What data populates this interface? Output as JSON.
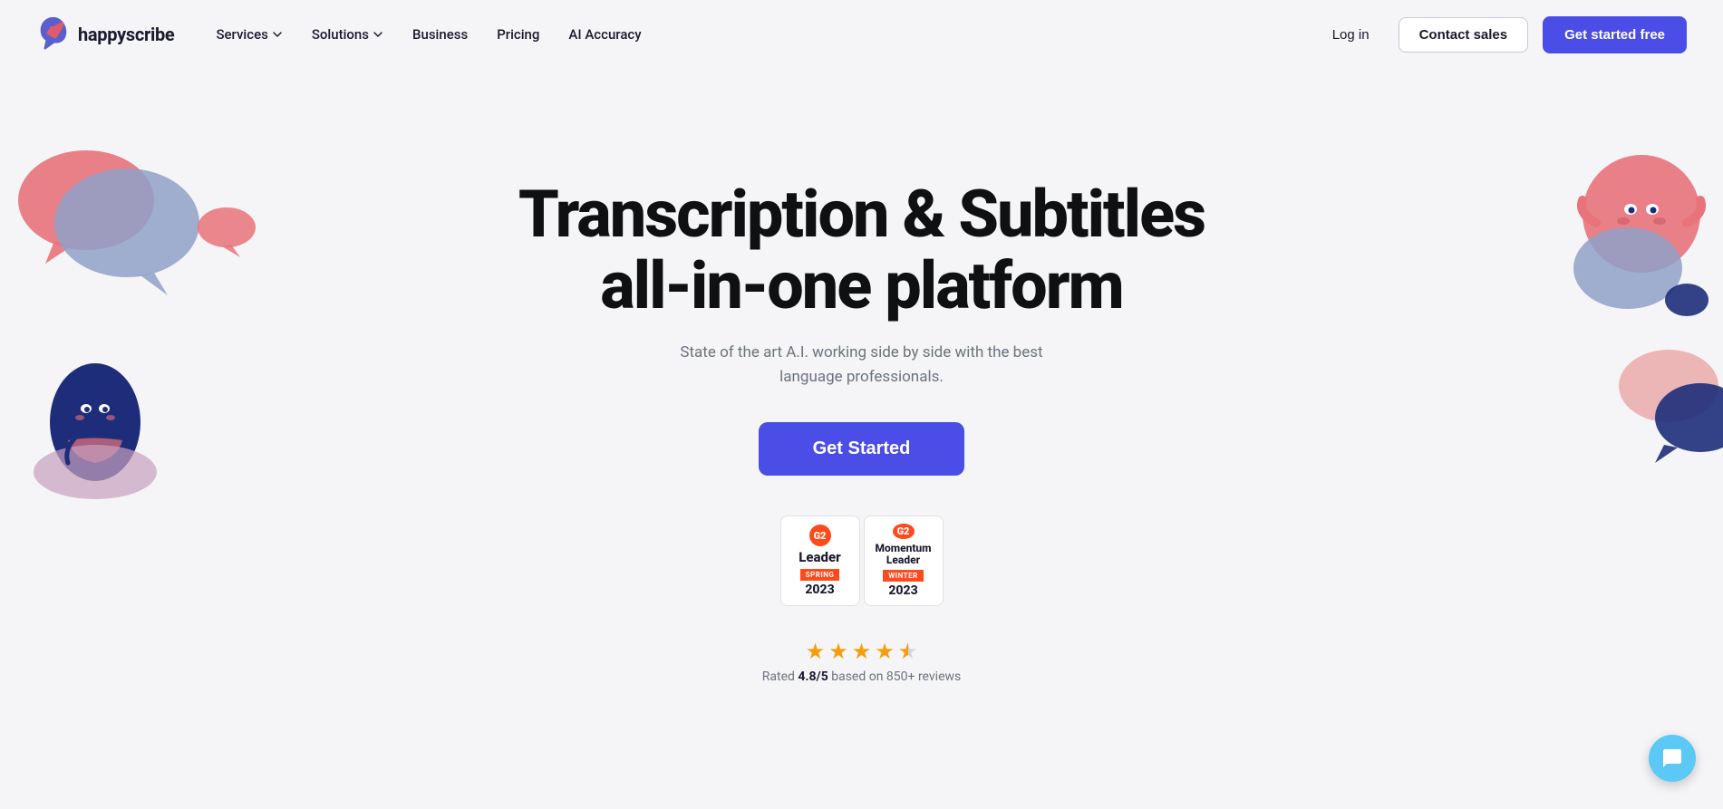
{
  "nav": {
    "logo_text": "happyscribe",
    "links": [
      {
        "label": "Services",
        "has_dropdown": true
      },
      {
        "label": "Solutions",
        "has_dropdown": true
      },
      {
        "label": "Business",
        "has_dropdown": false
      },
      {
        "label": "Pricing",
        "has_dropdown": false
      },
      {
        "label": "AI Accuracy",
        "has_dropdown": false
      }
    ],
    "login_label": "Log in",
    "contact_label": "Contact sales",
    "get_started_label": "Get started free"
  },
  "hero": {
    "title_line1": "Transcription & Subtitles",
    "title_line2": "all-in-one platform",
    "subtitle": "State of the art A.I. working side by side with the best language professionals.",
    "cta_label": "Get Started",
    "badges": [
      {
        "g2_label": "G2",
        "title": "Leader",
        "subtitle": "SPRING",
        "year": "2023"
      },
      {
        "g2_label": "G2",
        "title": "Momentum Leader",
        "subtitle": "WINTER",
        "year": "2023"
      }
    ],
    "stars_count": 4.8,
    "rating_text": "Rated",
    "rating_value": "4.8/5",
    "rating_suffix": "based on 850+ reviews"
  },
  "chat": {
    "aria_label": "Open chat support"
  }
}
